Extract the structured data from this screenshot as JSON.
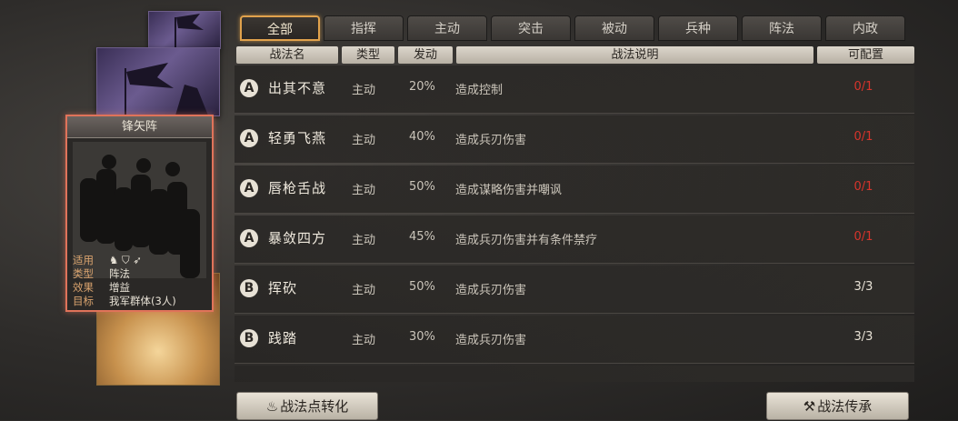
{
  "tabs": [
    {
      "label": "全部",
      "active": true
    },
    {
      "label": "指挥",
      "active": false
    },
    {
      "label": "主动",
      "active": false
    },
    {
      "label": "突击",
      "active": false
    },
    {
      "label": "被动",
      "active": false
    },
    {
      "label": "兵种",
      "active": false
    },
    {
      "label": "阵法",
      "active": false
    },
    {
      "label": "内政",
      "active": false
    }
  ],
  "columns": {
    "name": "战法名",
    "type": "类型",
    "rate": "发动",
    "desc": "战法说明",
    "cap": "可配置"
  },
  "skills": [
    {
      "grade": "A",
      "name": "出其不意",
      "type": "主动",
      "rate": "20%",
      "desc": "造成控制",
      "cap": "0/1",
      "cap_color": "red"
    },
    {
      "grade": "A",
      "name": "轻勇飞燕",
      "type": "主动",
      "rate": "40%",
      "desc": "造成兵刃伤害",
      "cap": "0/1",
      "cap_color": "red"
    },
    {
      "grade": "A",
      "name": "唇枪舌战",
      "type": "主动",
      "rate": "50%",
      "desc": "造成谋略伤害并嘲讽",
      "cap": "0/1",
      "cap_color": "red"
    },
    {
      "grade": "A",
      "name": "暴敛四方",
      "type": "主动",
      "rate": "45%",
      "desc": "造成兵刃伤害并有条件禁疗",
      "cap": "0/1",
      "cap_color": "red"
    },
    {
      "grade": "B",
      "name": "挥砍",
      "type": "主动",
      "rate": "50%",
      "desc": "造成兵刃伤害",
      "cap": "3/3",
      "cap_color": "white"
    },
    {
      "grade": "B",
      "name": "践踏",
      "type": "主动",
      "rate": "30%",
      "desc": "造成兵刃伤害",
      "cap": "3/3",
      "cap_color": "white"
    }
  ],
  "card": {
    "title": "锋矢阵",
    "labels": {
      "apply": "适用",
      "type": "类型",
      "effect": "效果",
      "target": "目标"
    },
    "type": "阵法",
    "effect": "增益",
    "target": "我军群体(3人)",
    "apply_icons": [
      "cavalry-icon",
      "shield-icon",
      "archer-icon"
    ]
  },
  "buttons": {
    "convert": "战法点转化",
    "inherit": "战法传承"
  },
  "colors": {
    "accent": "#e1a24c",
    "card_border": "#e0735a",
    "cap_red": "#d8342b"
  }
}
